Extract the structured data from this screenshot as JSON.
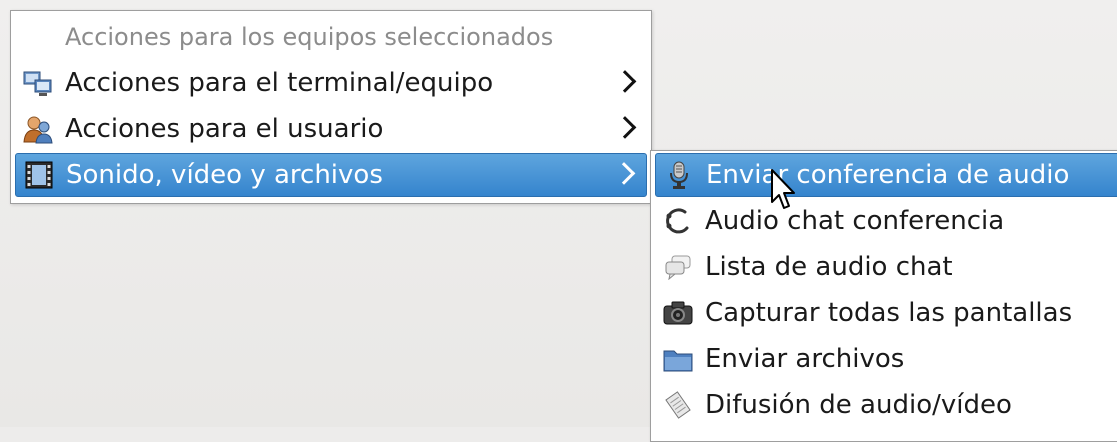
{
  "main_menu": {
    "header": "Acciones para los equipos seleccionados",
    "items": [
      {
        "label": "Acciones para el terminal/equipo",
        "icon": "computers-icon",
        "has_submenu": true
      },
      {
        "label": "Acciones para el usuario",
        "icon": "user-icon",
        "has_submenu": true
      },
      {
        "label": "Sonido, vídeo y archivos",
        "icon": "film-icon",
        "has_submenu": true,
        "active": true
      }
    ]
  },
  "sub_menu": {
    "items": [
      {
        "label": "Enviar conferencia de audio",
        "icon": "microphone-icon",
        "active": true
      },
      {
        "label": "Audio chat conferencia",
        "icon": "audio-chat-icon"
      },
      {
        "label": "Lista de audio chat",
        "icon": "chat-bubbles-icon"
      },
      {
        "label": "Capturar todas las pantallas",
        "icon": "camera-icon"
      },
      {
        "label": "Enviar archivos",
        "icon": "folder-icon"
      },
      {
        "label": "Difusión de audio/vídeo",
        "icon": "broadcast-icon"
      }
    ]
  },
  "colors": {
    "highlight": "#3584cd",
    "highlight_border": "#2b6eae",
    "header_text": "#8c8c8c",
    "background": "#edeceb"
  },
  "cursor": "arrow-pointer-icon"
}
